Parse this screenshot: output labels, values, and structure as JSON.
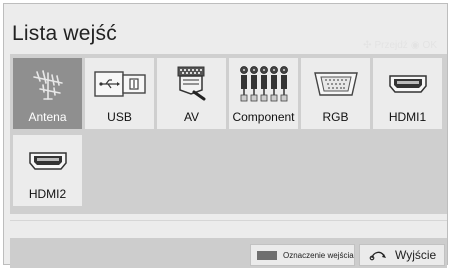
{
  "header": {
    "title": "Lista wejść",
    "hint_move": "Przejdź",
    "hint_ok": "OK"
  },
  "inputs": [
    {
      "label": "Antena",
      "icon": "antenna-icon",
      "selected": true
    },
    {
      "label": "USB",
      "icon": "usb-icon",
      "selected": false
    },
    {
      "label": "AV",
      "icon": "scart-av-icon",
      "selected": false
    },
    {
      "label": "Component",
      "icon": "component-rca-icon",
      "selected": false
    },
    {
      "label": "RGB",
      "icon": "vga-rgb-icon",
      "selected": false
    },
    {
      "label": "HDMI1",
      "icon": "hdmi-icon",
      "selected": false
    },
    {
      "label": "HDMI2",
      "icon": "hdmi-icon",
      "selected": false
    }
  ],
  "footer": {
    "mark_label": "Oznaczenie wejścia",
    "exit_label": "Wyjście"
  },
  "colors": {
    "selected_tile": "#8f8f8f",
    "tile": "#ececec",
    "grid_background": "#cfcfcf",
    "mark_swatch": "#6f6f6f"
  }
}
